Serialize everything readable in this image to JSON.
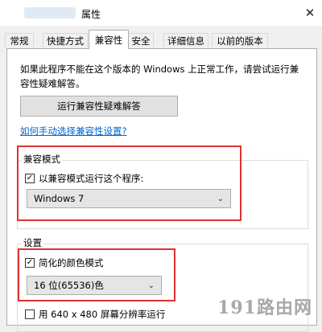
{
  "window": {
    "title": "属性",
    "close_glyph": "✕"
  },
  "tabs": [
    {
      "label": "常规",
      "active": false
    },
    {
      "label": "快捷方式",
      "active": false
    },
    {
      "label": "兼容性",
      "active": true
    },
    {
      "label": "安全",
      "active": false
    },
    {
      "label": "详细信息",
      "active": false
    },
    {
      "label": "以前的版本",
      "active": false
    }
  ],
  "compat": {
    "description": "如果此程序不能在这个版本的 Windows 上正常工作，请尝试运行兼容性疑难解答。",
    "troubleshoot_button": "运行兼容性疑难解答",
    "manual_link": "如何手动选择兼容性设置?",
    "mode_group": {
      "title": "兼容模式",
      "checkbox_label": "以兼容模式运行这个程序:",
      "checked": true,
      "selected_os": "Windows 7"
    },
    "settings_group": {
      "title": "设置",
      "reduced_color_label": "简化的颜色模式",
      "reduced_color_checked": true,
      "color_depth": "16 位(65536)色",
      "resolution_label": "用 640 x 480 屏幕分辨率运行",
      "resolution_checked": false
    }
  },
  "watermark": "191路由网",
  "colors": {
    "highlight": "#e0312f",
    "link": "#0066cc"
  }
}
